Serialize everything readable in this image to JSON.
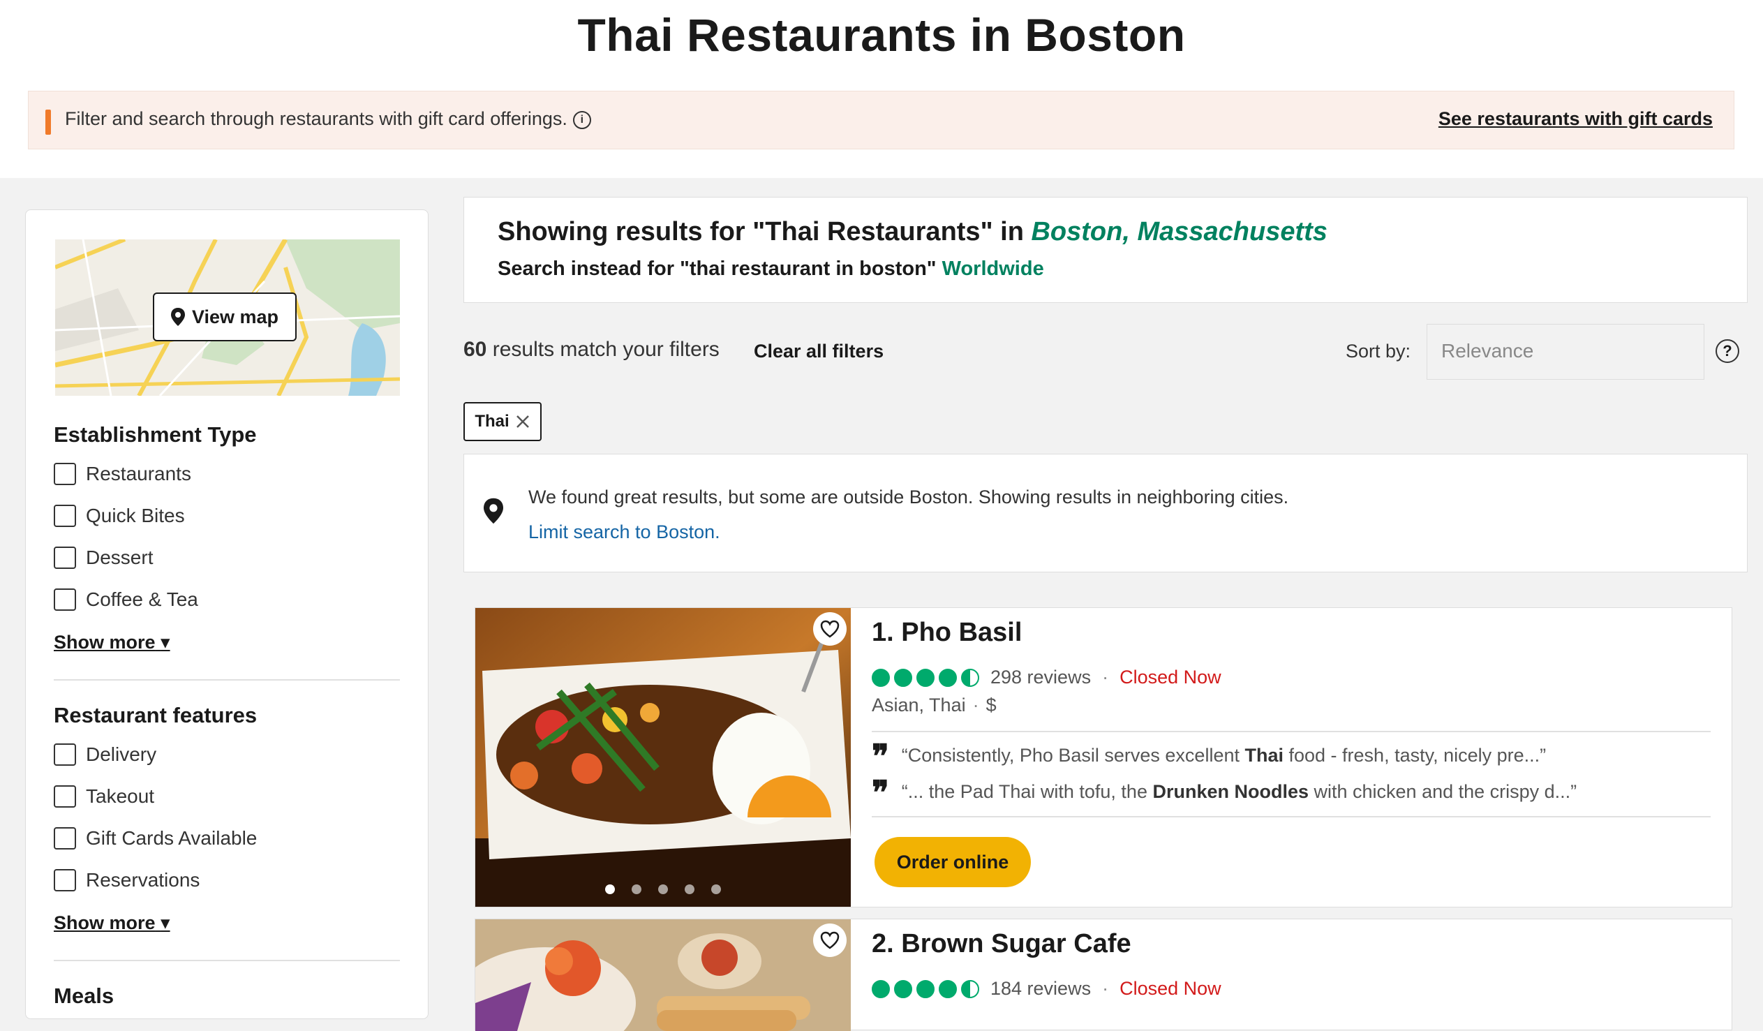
{
  "header": {
    "title": "Thai Restaurants in Boston",
    "gift_text": "Filter and search through restaurants with gift card offerings.",
    "gift_link": "See restaurants with gift cards"
  },
  "sidebar": {
    "view_map": "View map",
    "sections": [
      {
        "title": "Establishment Type",
        "items": [
          "Restaurants",
          "Quick Bites",
          "Dessert",
          "Coffee & Tea"
        ],
        "show_more": "Show more"
      },
      {
        "title": "Restaurant features",
        "items": [
          "Delivery",
          "Takeout",
          "Gift Cards Available",
          "Reservations"
        ],
        "show_more": "Show more"
      },
      {
        "title": "Meals"
      }
    ]
  },
  "results": {
    "showing_prefix": "Showing results for \"Thai Restaurants\" in",
    "location": "Boston, Massachusetts",
    "search_instead": "Search instead for \"thai restaurant in boston\"",
    "worldwide": "Worldwide",
    "count": "60",
    "count_suffix": "results match your filters",
    "clear_all": "Clear all filters",
    "sort_label": "Sort by:",
    "sort_value": "Relevance",
    "active_filter": "Thai"
  },
  "notice": {
    "text": "We found great results, but some are outside Boston. Showing results in neighboring cities.",
    "link": "Limit search to Boston."
  },
  "restaurants": [
    {
      "title": "1. Pho Basil",
      "rating": 4.5,
      "reviews": "298 reviews",
      "status": "Closed Now",
      "cuisine": "Asian, Thai",
      "price": "$",
      "quote1_pre": "“Consistently, Pho Basil serves excellent ",
      "quote1_bold": "Thai",
      "quote1_post": " food - fresh, tasty, nicely pre...”",
      "quote2_pre": "“... the Pad Thai with tofu, the ",
      "quote2_bold": "Drunken Noodles",
      "quote2_post": " with chicken and the crispy d...”",
      "order": "Order online"
    },
    {
      "title": "2. Brown Sugar Cafe",
      "rating": 4.5,
      "reviews": "184 reviews",
      "status": "Closed Now"
    }
  ],
  "colors": {
    "accent_green": "#00aa6c",
    "link_green": "#00815f",
    "closed_red": "#d21a1a",
    "order_yellow": "#f2b203",
    "gift_accent": "#f07a2a"
  }
}
